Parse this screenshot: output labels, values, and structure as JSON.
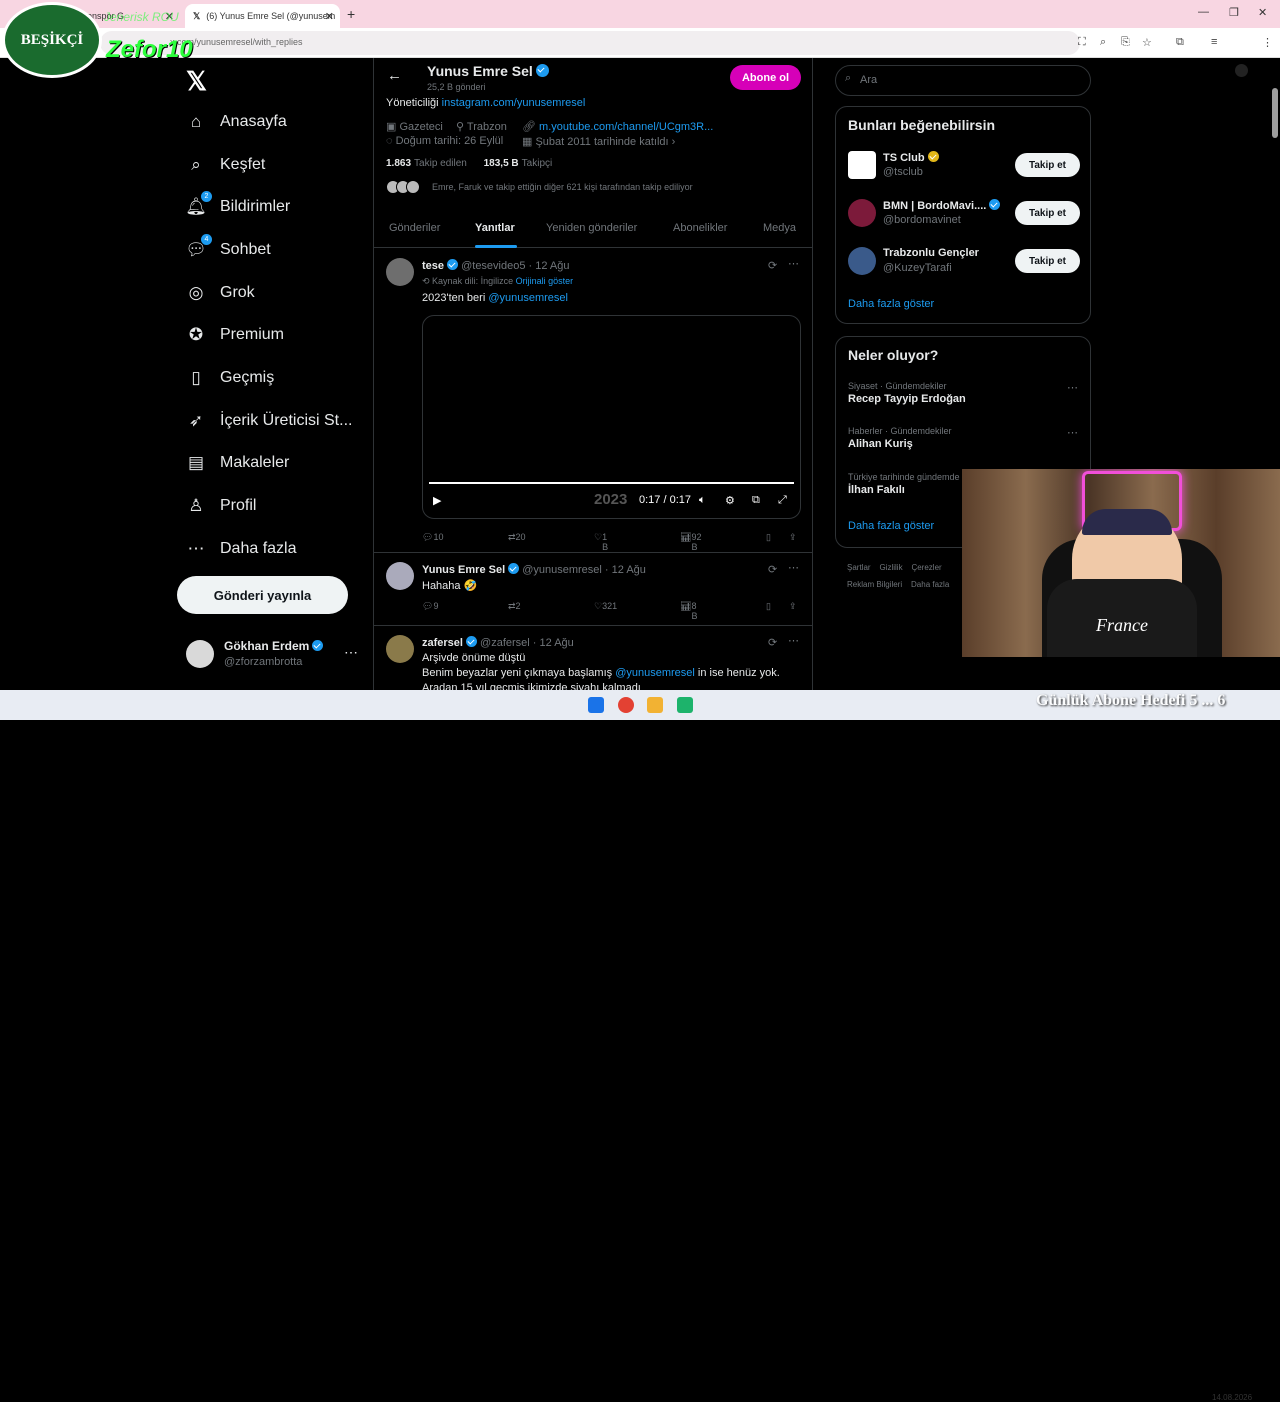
{
  "browser": {
    "tab1_title": "Etkisi: Trabzonspor G",
    "tab2_title": "(6) Yunus Emre Sel (@yunusem",
    "url": "x.com/yunusemresel/with_replies"
  },
  "overlay": {
    "logo_text": "BEŞİKÇİ",
    "zefor": "Zefor10",
    "rou": "Jenerisk ROU"
  },
  "nav": {
    "items": [
      {
        "label": "Anasayfa",
        "icon": "home-icon"
      },
      {
        "label": "Keşfet",
        "icon": "search-icon"
      },
      {
        "label": "Bildirimler",
        "icon": "bell-icon",
        "badge": "2"
      },
      {
        "label": "Sohbet",
        "icon": "chat-icon",
        "badge": "4"
      },
      {
        "label": "Grok",
        "icon": "grok-icon"
      },
      {
        "label": "Premium",
        "icon": "premium-icon"
      },
      {
        "label": "Geçmiş",
        "icon": "bookmark-icon"
      },
      {
        "label": "İçerik Üreticisi St...",
        "icon": "rocket-icon"
      },
      {
        "label": "Makaleler",
        "icon": "article-icon"
      },
      {
        "label": "Profil",
        "icon": "person-icon"
      },
      {
        "label": "Daha fazla",
        "icon": "more-circle-icon"
      }
    ],
    "post_button": "Gönderi yayınla",
    "account": {
      "name": "Gökhan Erdem",
      "handle": "@zforzambrotta"
    }
  },
  "profile": {
    "name": "Yunus Emre Sel",
    "post_count": "25,2 B gönderi",
    "subscribe_label": "Abone ol",
    "bio_prefix": "Yöneticiliği ",
    "bio_link": "instagram.com/yunusemresel",
    "job": "Gazeteci",
    "location": "Trabzon",
    "website": "m.youtube.com/channel/UCgm3R...",
    "birth": "Doğum tarihi: 26 Eylül",
    "joined": "Şubat 2011 tarihinde katıldı",
    "following_count": "1.863",
    "following_label": "Takip edilen",
    "followers_count": "183,5 B",
    "followers_label": "Takipçi",
    "followed_by": "Emre, Faruk ve takip ettiğin diğer 621 kişi tarafından takip ediliyor",
    "tabs": [
      "Gönderiler",
      "Yanıtlar",
      "Yeniden gönderiler",
      "Abonelikler",
      "Medya"
    ]
  },
  "tweets": [
    {
      "name": "tese",
      "handle": "@tesevideo5",
      "date": "12 Ağu",
      "translation": "Kaynak dili: İngilizce",
      "show_original": "Orijinali göster",
      "text_prefix": "2023'ten beri ",
      "mention": "@yunusemresel",
      "video_time": "0:17 / 0:17",
      "video_year": "2023",
      "replies": "10",
      "reposts": "20",
      "likes": "1 B",
      "views": "92 B"
    },
    {
      "name": "Yunus Emre Sel",
      "handle": "@yunusemresel",
      "date": "12 Ağu",
      "text": "Hahaha 🤣",
      "replies": "9",
      "reposts": "2",
      "likes": "321",
      "views": "8 B"
    },
    {
      "name": "zafersel",
      "handle": "@zafersel",
      "date": "12 Ağu",
      "line1": "Arşivde önüme düştü",
      "line2_prefix": "Benim beyazlar yeni çıkmaya başlamış ",
      "line2_mention": "@yunusemresel",
      "line2_suffix": " in ise henüz yok.",
      "line3": "Aradan 15 yıl geçmiş ikimizde siyahı kalmadı"
    }
  ],
  "right": {
    "search_placeholder": "Ara",
    "suggest_title": "Bunları beğenebilirsin",
    "suggestions": [
      {
        "name": "TS Club",
        "handle": "@tsclub",
        "button": "Takip et"
      },
      {
        "name": "BMN | BordoMavi....",
        "handle": "@bordomavinet",
        "button": "Takip et"
      },
      {
        "name": "Trabzonlu Gençler",
        "handle": "@KuzeyTarafi",
        "button": "Takip et"
      }
    ],
    "show_more": "Daha fazla göster",
    "trends_title": "Neler oluyor?",
    "trends": [
      {
        "context": "Siyaset · Gündemdekiler",
        "title": "Recep Tayyip Erdoğan"
      },
      {
        "context": "Haberler · Gündemdekiler",
        "title": "Alihan Kuriş"
      },
      {
        "context": "Türkiye tarihinde gündemde",
        "title": "İlhan Fakılı"
      }
    ],
    "footer1": [
      "Şartlar",
      "Gizlilik",
      "Çerezler"
    ],
    "footer2": [
      "Reklam Bilgileri",
      "Daha fazla"
    ]
  },
  "stream": {
    "banner": "Günlük Abone Hedefi 5 ... 6",
    "shirt": "France",
    "clock": "14.08.2026"
  }
}
